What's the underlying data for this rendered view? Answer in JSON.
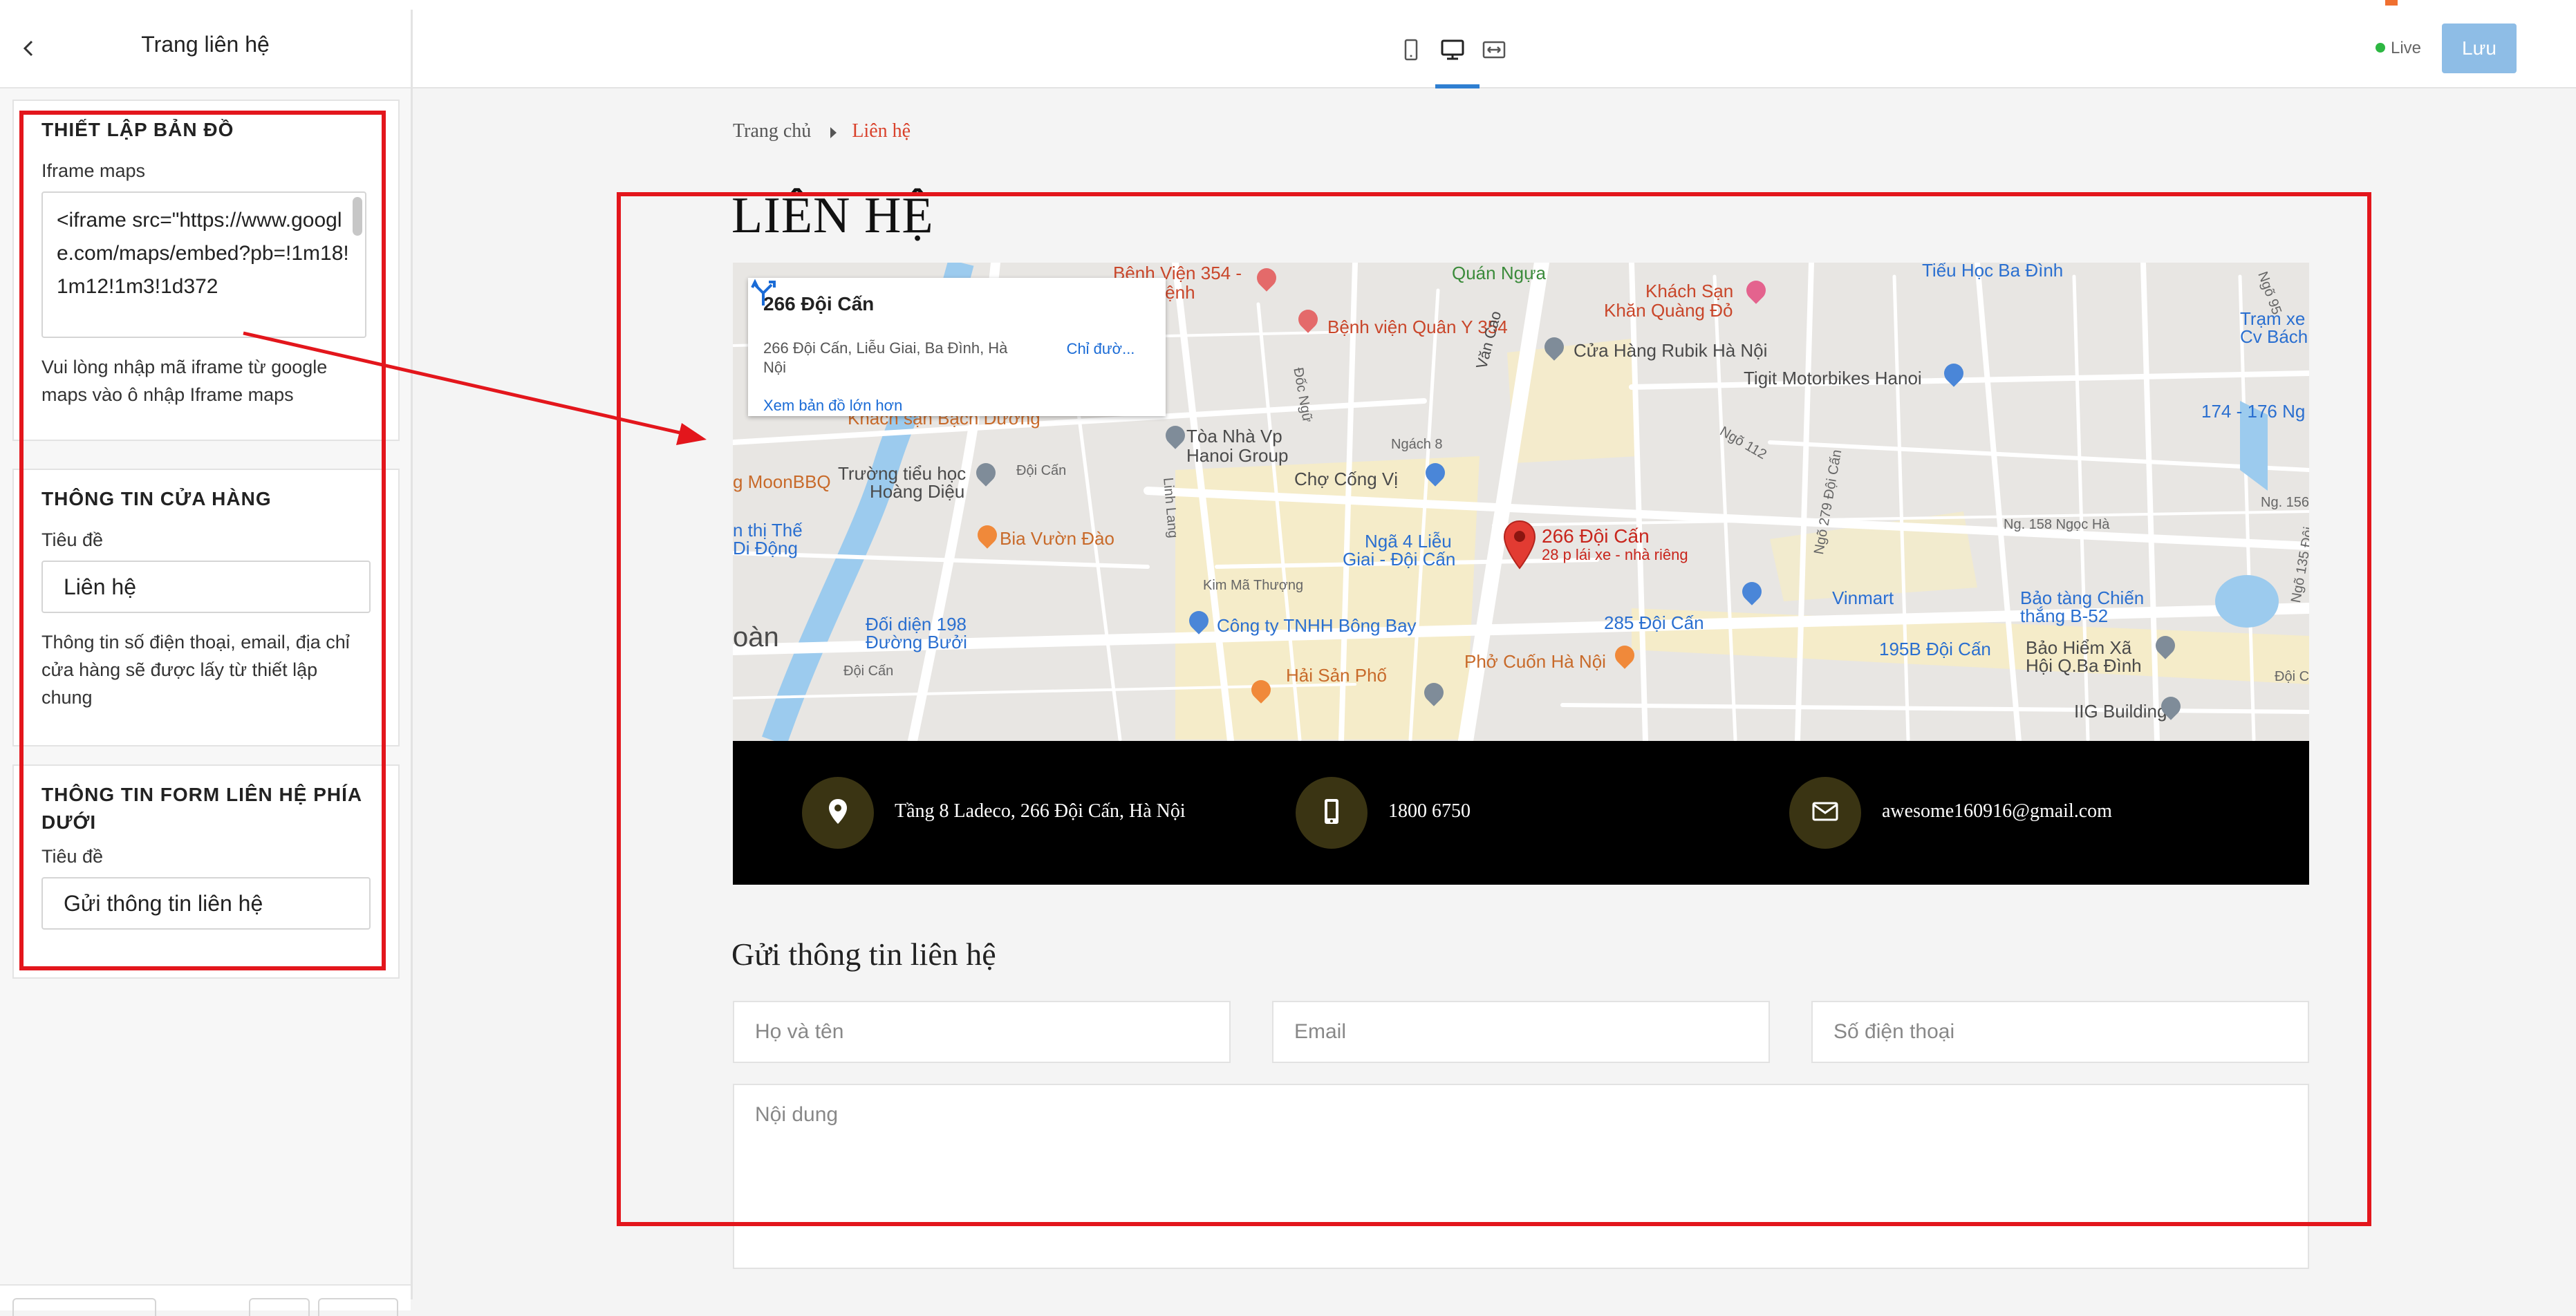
{
  "sidebar": {
    "title": "Trang liên hệ",
    "map_settings": {
      "heading": "THIẾT LẬP BẢN ĐỒ",
      "iframe_label": "Iframe maps",
      "iframe_value": "<iframe src=\"https://www.google.com/maps/embed?pb=!1m18!1m12!1m3!1d372",
      "help": "Vui lòng nhập mã iframe từ google maps vào ô nhập Iframe maps"
    },
    "store_info": {
      "heading": "THÔNG TIN CỬA HÀNG",
      "title_label": "Tiêu đề",
      "title_value": "Liên hệ",
      "help": "Thông tin số điện thoại, email, địa chỉ cửa hàng sẽ được lấy từ thiết lập chung"
    },
    "contact_form": {
      "heading": "THÔNG TIN FORM LIÊN HỆ PHÍA DƯỚI",
      "title_label": "Tiêu đề",
      "title_value": "Gửi thông tin liên hệ"
    }
  },
  "toolbar": {
    "devices": [
      "mobile-icon",
      "desktop-icon",
      "fullwidth-icon"
    ],
    "active_device": "desktop",
    "live_label": "Live",
    "save_label": "Lưu"
  },
  "preview": {
    "breadcrumb": {
      "home": "Trang chủ",
      "current": "Liên hệ"
    },
    "page_title": "LIÊN HỆ",
    "map": {
      "card": {
        "name": "266 Đội Cấn",
        "address": "266 Đội Cấn, Liễu Giai, Ba Đình, Hà Nội",
        "directions": "Chỉ đườ...",
        "larger_map": "Xem bản đồ lớn hơn"
      },
      "marker_label": "266 Đội Cấn",
      "marker_sub": "28 p lái xe - nhà riêng",
      "labels": {
        "l1": "Bệnh Viện 354 -",
        "l2": "hám Bệnh",
        "l3": "Bệnh viện Quân Y 354",
        "l4": "Quán Ngựa",
        "l5": "Khách Sạn",
        "l6": "Khăn Quàng Đỏ",
        "l7": "Cửa Hàng Rubik Hà Nội",
        "l8": "Tigit Motorbikes Hanoi",
        "l9": "Tiểu Học Ba Đình",
        "l10": "Trạm xe",
        "l11": "Cv Bách",
        "l12": "174 - 176 Ng",
        "l13": "Khách sạn Bạch Dương",
        "l14": "Tòa Nhà Vp",
        "l15": "Hanoi Group",
        "l16": "Chợ Cống Vị",
        "l17": "g MoonBBQ",
        "l18": "Trường tiểu học",
        "l19": "Hoàng Diệu",
        "l20": "n thị Thế",
        "l21": "Di Động",
        "l22": "Bia Vườn Đào",
        "l23": "Ngã 4 Liễu",
        "l24": "Giai - Đội Cấn",
        "l25": "Đối diện 198",
        "l26": "Đường Bưởi",
        "l27": "Công ty TNHH Bông Bay",
        "l28": "Hải Sản Phố",
        "l29": "Phở Cuốn Hà Nội",
        "l30": "Vinmart",
        "l31": "285 Đội Cấn",
        "l32": "Bảo tàng Chiến",
        "l33": "thắng B-52",
        "l34": "195B Đội Cấn",
        "l35": "Bảo Hiểm Xã",
        "l36": "Hội Q.Ba Đình",
        "l37": "IIG Building",
        "l38": "oàn",
        "l39": "Văn Cao",
        "s1": "Ngách 8",
        "s2": "Đội Cấn",
        "s3": "Kim Mã Thượng",
        "s4": "Ngõ 112",
        "s5": "Ngõ 279 Đội Cấn",
        "s6": "Ng. 158 Ngọc Hà",
        "s7": "Ng. 156",
        "s8": "Đốc Ngữ",
        "s9": "Linh Lang",
        "s10": "Đội Cấn",
        "s11": "Đội Cấn",
        "s12": "Ngõ 135 Đội",
        "s13": "Ngõ 95"
      }
    },
    "info_bar": {
      "address": "Tầng 8 Ladeco, 266 Đội Cấn, Hà Nội",
      "phone": "1800 6750",
      "email": "awesome160916@gmail.com"
    },
    "form": {
      "title": "Gửi thông tin liên hệ",
      "name_placeholder": "Họ và tên",
      "email_placeholder": "Email",
      "phone_placeholder": "Số điện thoại",
      "content_placeholder": "Nội dung"
    }
  },
  "colors": {
    "annotation": "#e3161c",
    "accent": "#2f7fd1",
    "save_button": "#8ebde6",
    "breadcrumb_current": "#d9412b",
    "info_bar": "#000000",
    "info_icon_bg": "#3a3413"
  }
}
